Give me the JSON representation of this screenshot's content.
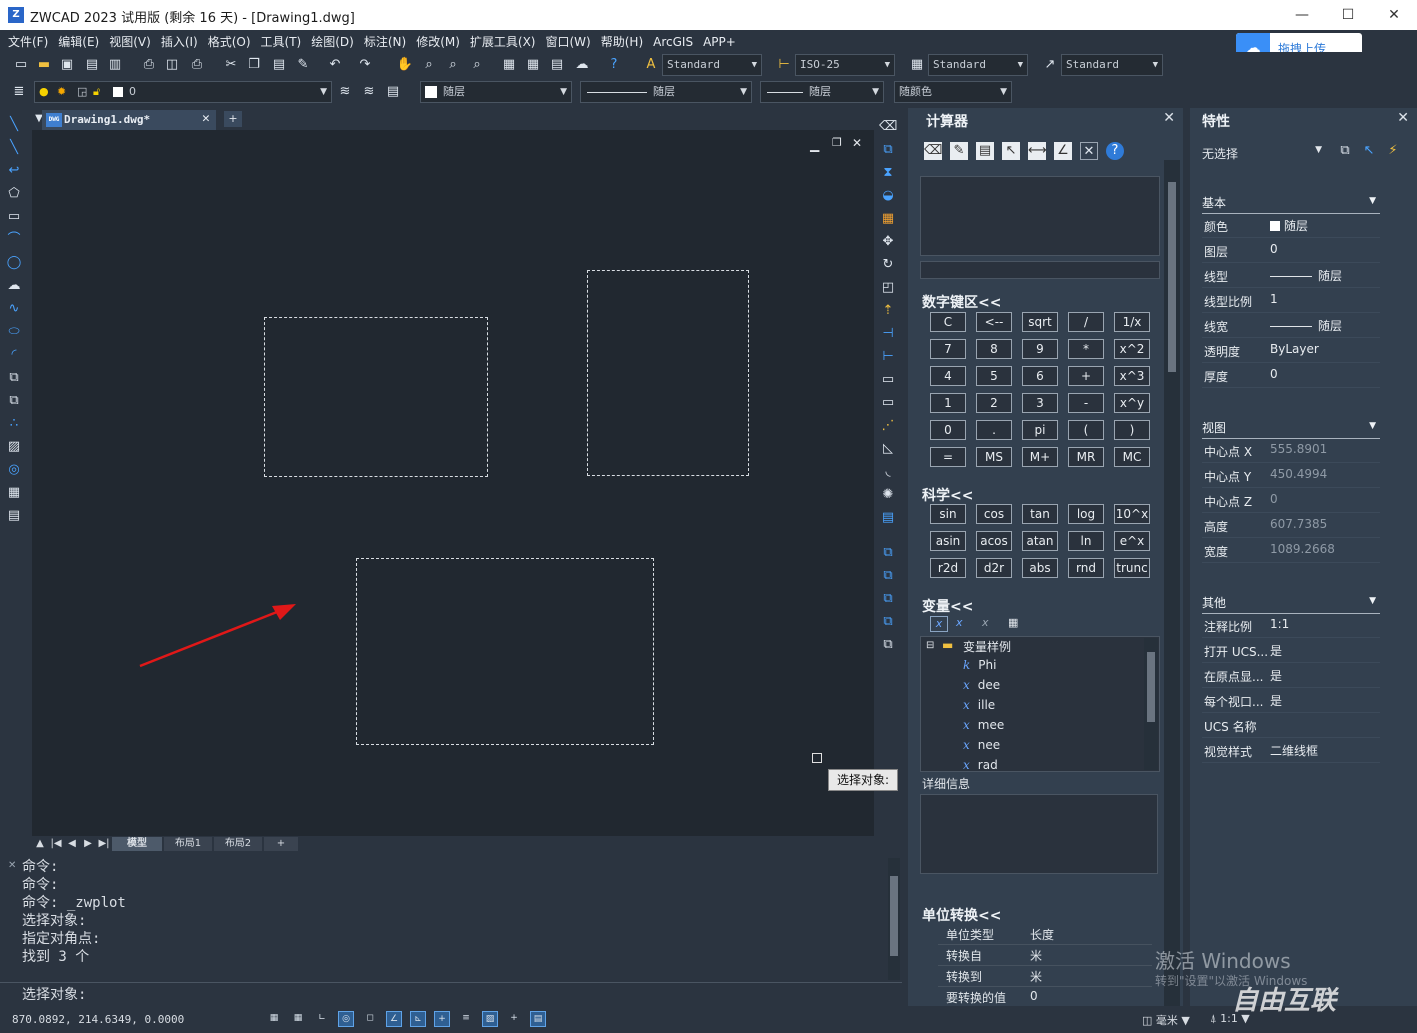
{
  "window": {
    "title": "ZWCAD 2023 试用版 (剩余 16 天) - [Drawing1.dwg]",
    "logo": "Z",
    "min": "—",
    "max": "☐",
    "close": "✕"
  },
  "menu": [
    "文件(F)",
    "编辑(E)",
    "视图(V)",
    "插入(I)",
    "格式(O)",
    "工具(T)",
    "绘图(D)",
    "标注(N)",
    "修改(M)",
    "扩展工具(X)",
    "窗口(W)",
    "帮助(H)",
    "ArcGIS",
    "APP+"
  ],
  "upload": {
    "label": "拖拽上传"
  },
  "toolbar1": {
    "text_style": "Standard",
    "dim_style": "ISO-25",
    "table_style": "Standard",
    "mleader_style": "Standard"
  },
  "toolbar2": {
    "layer": "0",
    "color": "随层",
    "linetype": "随层",
    "lineweight": "随层",
    "plotstyle": "随颜色"
  },
  "doc_tab": {
    "label": "Drawing1.dwg*",
    "badge": "DWG"
  },
  "layout_tabs": [
    "模型",
    "布局1",
    "布局2",
    "+"
  ],
  "command": {
    "history": [
      "命令:",
      "命令:",
      "命令: _zwplot",
      "选择对象:",
      "指定对角点:",
      "找到 3 个"
    ],
    "prompt": "选择对象:"
  },
  "tooltip": "选择对象:",
  "status": {
    "coords": "870.0892, 214.6349, 0.0000",
    "units": "毫米",
    "scale": "1:1"
  },
  "calculator": {
    "title": "计算器",
    "numpad_title": "数字键区<<",
    "numpad": [
      [
        "C",
        "<--",
        "sqrt",
        "/",
        "1/x"
      ],
      [
        "7",
        "8",
        "9",
        "*",
        "x^2"
      ],
      [
        "4",
        "5",
        "6",
        "+",
        "x^3"
      ],
      [
        "1",
        "2",
        "3",
        "-",
        "x^y"
      ],
      [
        "0",
        ".",
        "pi",
        "(",
        ")"
      ],
      [
        "=",
        "MS",
        "M+",
        "MR",
        "MC"
      ]
    ],
    "sci_title": "科学<<",
    "sci": [
      [
        "sin",
        "cos",
        "tan",
        "log",
        "10^x"
      ],
      [
        "asin",
        "acos",
        "atan",
        "ln",
        "e^x"
      ],
      [
        "r2d",
        "d2r",
        "abs",
        "rnd",
        "trunc"
      ]
    ],
    "var_title": "变量<<",
    "var_folder": "变量样例",
    "vars": [
      {
        "icon": "k",
        "name": "Phi"
      },
      {
        "icon": "x",
        "name": "dee"
      },
      {
        "icon": "x",
        "name": "ille"
      },
      {
        "icon": "x",
        "name": "mee"
      },
      {
        "icon": "x",
        "name": "nee"
      },
      {
        "icon": "x",
        "name": "rad"
      }
    ],
    "detail_title": "详细信息",
    "unit_title": "单位转换<<",
    "units": [
      [
        "单位类型",
        "长度"
      ],
      [
        "转换自",
        "米"
      ],
      [
        "转换到",
        "米"
      ],
      [
        "要转换的值",
        "0"
      ]
    ]
  },
  "properties": {
    "title": "特性",
    "selection": "无选择",
    "groups": {
      "basic": {
        "title": "基本",
        "rows": [
          [
            "颜色",
            "随层"
          ],
          [
            "图层",
            "0"
          ],
          [
            "线型",
            "随层"
          ],
          [
            "线型比例",
            "1"
          ],
          [
            "线宽",
            "随层"
          ],
          [
            "透明度",
            "ByLayer"
          ],
          [
            "厚度",
            "0"
          ]
        ]
      },
      "view": {
        "title": "视图",
        "rows": [
          [
            "中心点 X",
            "555.8901"
          ],
          [
            "中心点 Y",
            "450.4994"
          ],
          [
            "中心点 Z",
            "0"
          ],
          [
            "高度",
            "607.7385"
          ],
          [
            "宽度",
            "1089.2668"
          ]
        ]
      },
      "misc": {
        "title": "其他",
        "rows": [
          [
            "注释比例",
            "1:1"
          ],
          [
            "打开 UCS...",
            "是"
          ],
          [
            "在原点显...",
            "是"
          ],
          [
            "每个视口...",
            "是"
          ],
          [
            "UCS 名称",
            ""
          ],
          [
            "视觉样式",
            "二维线框"
          ]
        ]
      }
    }
  },
  "watermark": {
    "line1": "激活 Windows",
    "line2": "转到\"设置\"以激活 Windows",
    "brand": "自由互联"
  }
}
